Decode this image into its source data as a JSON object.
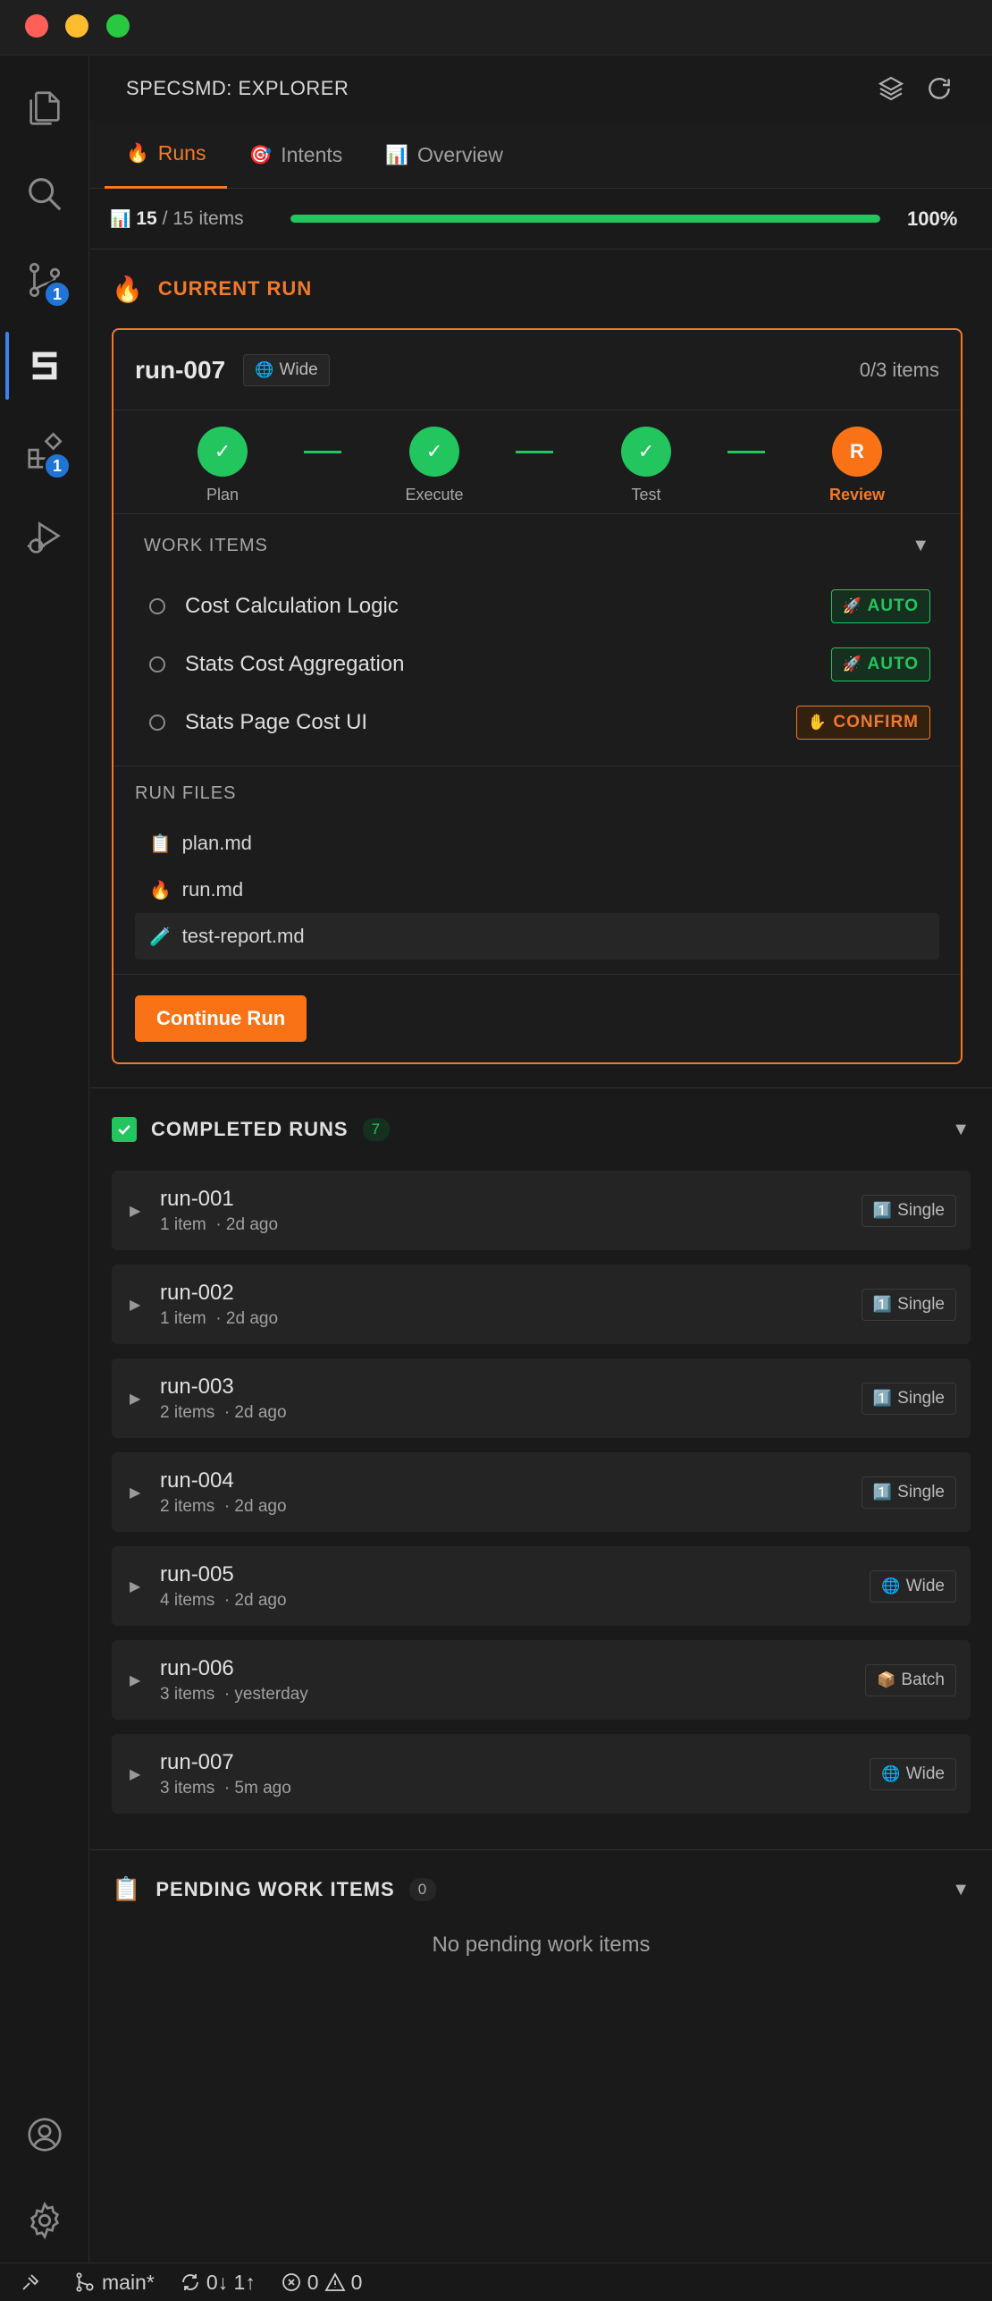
{
  "panel": {
    "title": "SPECSMD: EXPLORER"
  },
  "tabs": [
    {
      "icon": "🔥",
      "label": "Runs"
    },
    {
      "icon": "🎯",
      "label": "Intents"
    },
    {
      "icon": "📊",
      "label": "Overview"
    }
  ],
  "progress": {
    "icon": "📊",
    "done": "15",
    "total_text": "/ 15 items",
    "percent_text": "100%",
    "fraction": 1.0
  },
  "current_run": {
    "section_icon": "🔥",
    "section_title": "CURRENT RUN",
    "name": "run-007",
    "scope_icon": "🌐",
    "scope": "Wide",
    "items_count": "0/3 items",
    "steps": [
      {
        "label": "Plan",
        "mark": "✓",
        "state": "done"
      },
      {
        "label": "Execute",
        "mark": "✓",
        "state": "done"
      },
      {
        "label": "Test",
        "mark": "✓",
        "state": "done"
      },
      {
        "label": "Review",
        "mark": "R",
        "state": "current"
      }
    ],
    "work_items_title": "WORK ITEMS",
    "work_items": [
      {
        "name": "Cost Calculation Logic",
        "mode_icon": "🚀",
        "mode": "AUTO"
      },
      {
        "name": "Stats Cost Aggregation",
        "mode_icon": "🚀",
        "mode": "AUTO"
      },
      {
        "name": "Stats Page Cost UI",
        "mode_icon": "✋",
        "mode": "CONFIRM"
      }
    ],
    "run_files_title": "RUN FILES",
    "run_files": [
      {
        "icon": "📋",
        "name": "plan.md"
      },
      {
        "icon": "🔥",
        "name": "run.md"
      },
      {
        "icon": "🧪",
        "name": "test-report.md"
      }
    ],
    "continue_label": "Continue Run"
  },
  "completed": {
    "title": "COMPLETED RUNS",
    "count": "7",
    "runs": [
      {
        "name": "run-001",
        "items": "1 item",
        "when": "· 2d ago",
        "scope_icon": "1️⃣",
        "scope": "Single"
      },
      {
        "name": "run-002",
        "items": "1 item",
        "when": "· 2d ago",
        "scope_icon": "1️⃣",
        "scope": "Single"
      },
      {
        "name": "run-003",
        "items": "2 items",
        "when": "· 2d ago",
        "scope_icon": "1️⃣",
        "scope": "Single"
      },
      {
        "name": "run-004",
        "items": "2 items",
        "when": "· 2d ago",
        "scope_icon": "1️⃣",
        "scope": "Single"
      },
      {
        "name": "run-005",
        "items": "4 items",
        "when": "· 2d ago",
        "scope_icon": "🌐",
        "scope": "Wide"
      },
      {
        "name": "run-006",
        "items": "3 items",
        "when": "· yesterday",
        "scope_icon": "📦",
        "scope": "Batch"
      },
      {
        "name": "run-007",
        "items": "3 items",
        "when": "· 5m ago",
        "scope_icon": "🌐",
        "scope": "Wide"
      }
    ]
  },
  "pending": {
    "icon": "📋",
    "title": "PENDING WORK ITEMS",
    "count": "0",
    "empty_text": "No pending work items"
  },
  "activity_badges": {
    "source_control": "1",
    "extensions": "1"
  },
  "statusbar": {
    "branch": "main*",
    "sync": "0↓ 1↑",
    "errors": "0",
    "warnings": "0"
  },
  "colors": {
    "accent": "#f07a2a",
    "success": "#22c55e",
    "badge": "#1f74d6"
  }
}
